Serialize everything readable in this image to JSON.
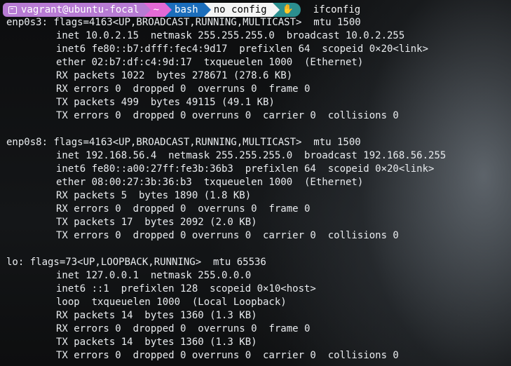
{
  "prompt": {
    "user_host": "vagrant@ubuntu-focal",
    "directory": "~",
    "shell": "bash",
    "git": "no config",
    "status_icon": "hand-icon",
    "command": "ifconfig"
  },
  "colors": {
    "user_segment": "#b77bd3",
    "dir_segment": "#e36ad6",
    "shell_segment": "#1b6dbb",
    "git_segment": "#f4f4f4",
    "status_segment": "#2b8f8f"
  },
  "output": [
    {
      "indent": false,
      "text": "enp0s3: flags=4163<UP,BROADCAST,RUNNING,MULTICAST>  mtu 1500"
    },
    {
      "indent": true,
      "text": "inet 10.0.2.15  netmask 255.255.255.0  broadcast 10.0.2.255"
    },
    {
      "indent": true,
      "text": "inet6 fe80::b7:dfff:fec4:9d17  prefixlen 64  scopeid 0×20<link>"
    },
    {
      "indent": true,
      "text": "ether 02:b7:df:c4:9d:17  txqueuelen 1000  (Ethernet)"
    },
    {
      "indent": true,
      "text": "RX packets 1022  bytes 278671 (278.6 KB)"
    },
    {
      "indent": true,
      "text": "RX errors 0  dropped 0  overruns 0  frame 0"
    },
    {
      "indent": true,
      "text": "TX packets 499  bytes 49115 (49.1 KB)"
    },
    {
      "indent": true,
      "text": "TX errors 0  dropped 0 overruns 0  carrier 0  collisions 0"
    },
    {
      "indent": false,
      "text": ""
    },
    {
      "indent": false,
      "text": "enp0s8: flags=4163<UP,BROADCAST,RUNNING,MULTICAST>  mtu 1500"
    },
    {
      "indent": true,
      "text": "inet 192.168.56.4  netmask 255.255.255.0  broadcast 192.168.56.255"
    },
    {
      "indent": true,
      "text": "inet6 fe80::a00:27ff:fe3b:36b3  prefixlen 64  scopeid 0×20<link>"
    },
    {
      "indent": true,
      "text": "ether 08:00:27:3b:36:b3  txqueuelen 1000  (Ethernet)"
    },
    {
      "indent": true,
      "text": "RX packets 5  bytes 1890 (1.8 KB)"
    },
    {
      "indent": true,
      "text": "RX errors 0  dropped 0  overruns 0  frame 0"
    },
    {
      "indent": true,
      "text": "TX packets 17  bytes 2092 (2.0 KB)"
    },
    {
      "indent": true,
      "text": "TX errors 0  dropped 0 overruns 0  carrier 0  collisions 0"
    },
    {
      "indent": false,
      "text": ""
    },
    {
      "indent": false,
      "text": "lo: flags=73<UP,LOOPBACK,RUNNING>  mtu 65536"
    },
    {
      "indent": true,
      "text": "inet 127.0.0.1  netmask 255.0.0.0"
    },
    {
      "indent": true,
      "text": "inet6 ::1  prefixlen 128  scopeid 0×10<host>"
    },
    {
      "indent": true,
      "text": "loop  txqueuelen 1000  (Local Loopback)"
    },
    {
      "indent": true,
      "text": "RX packets 14  bytes 1360 (1.3 KB)"
    },
    {
      "indent": true,
      "text": "RX errors 0  dropped 0  overruns 0  frame 0"
    },
    {
      "indent": true,
      "text": "TX packets 14  bytes 1360 (1.3 KB)"
    },
    {
      "indent": true,
      "text": "TX errors 0  dropped 0 overruns 0  carrier 0  collisions 0"
    }
  ]
}
